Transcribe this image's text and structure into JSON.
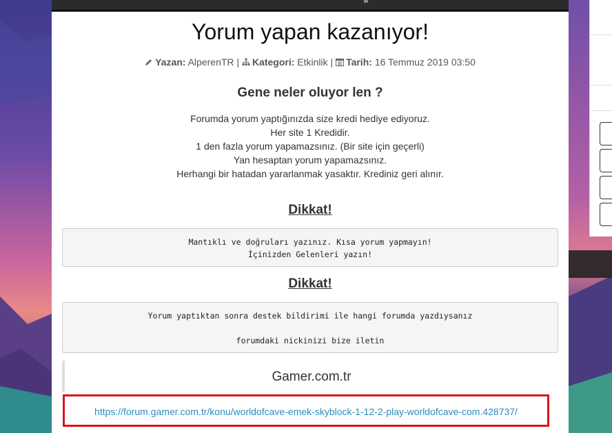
{
  "article": {
    "title": "Yorum yapan kazanıyor!",
    "meta": {
      "author_label": "Yazan:",
      "author": "AlperenTR",
      "category_label": "Kategori:",
      "category": "Etkinlik",
      "date_label": "Tarih:",
      "date": "16 Temmuz 2019 03:50",
      "separator": "|"
    },
    "subtitle": "Gene neler oluyor len ?",
    "lines": [
      "Forumda yorum yaptığınızda size kredi hediye ediyoruz.",
      "Her site 1 Kredidir.",
      "1 den fazla yorum yapamazsınız. (Bir site için geçerli)",
      "Yan hesaptan yorum yapamazsınız.",
      "Herhangi bir hatadan yararlanmak yasaktır. Krediniz geri alınır."
    ],
    "notices": [
      {
        "heading": "Dikkat!",
        "lines": [
          "Mantıklı ve doğruları yazınız. Kısa yorum yapmayın!",
          "İçinizden Gelenleri yazın!"
        ]
      },
      {
        "heading": "Dikkat!",
        "lines": [
          "Yorum yaptıktan sonra destek bildirimi ile hangi forumda yazdıysanız",
          "",
          "forumdaki nickinizi bize iletin"
        ]
      }
    ],
    "quote_title": "Gamer.com.tr",
    "link": "https://forum.gamer.com.tr/konu/worldofcave-emek-skyblock-1-12-2-play-worldofcave-com.428737/"
  },
  "icons": {
    "author": "pencil-icon",
    "category": "sitemap-icon",
    "date": "calendar-icon"
  },
  "colors": {
    "link": "#2a8bbd",
    "highlight_border": "#d9141b"
  }
}
